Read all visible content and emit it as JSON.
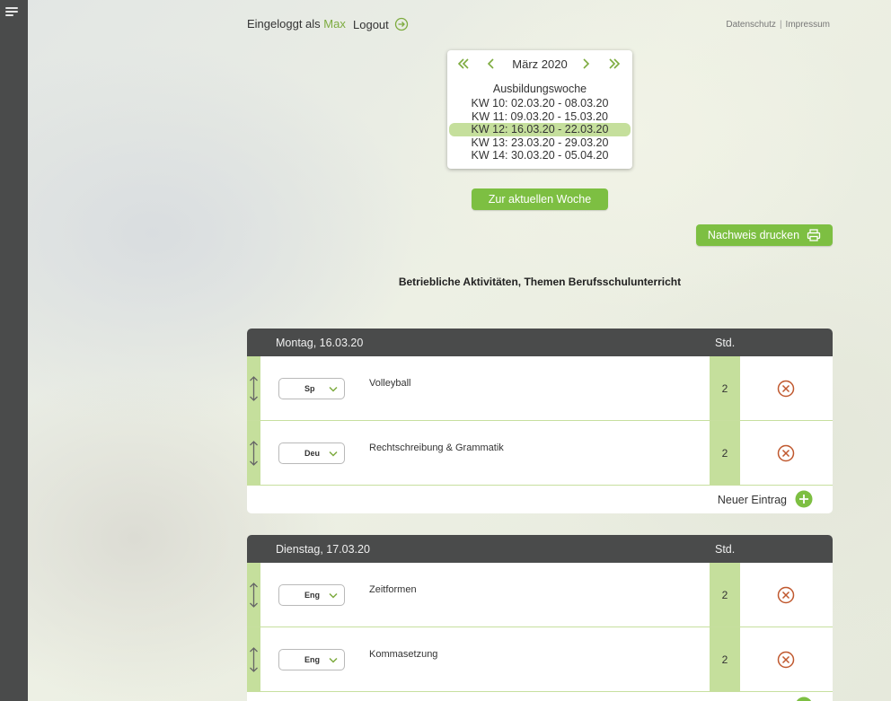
{
  "header": {
    "logged_in_prefix": "Eingeloggt als",
    "user_name": "Max",
    "logout_label": "Logout",
    "privacy_label": "Datenschutz",
    "separator": "|",
    "imprint_label": "Impressum"
  },
  "calendar": {
    "month_label": "März 2020",
    "title": "Ausbildungswoche",
    "weeks": [
      {
        "label": "KW 10: 02.03.20 - 08.03.20",
        "selected": false
      },
      {
        "label": "KW 11: 09.03.20 - 15.03.20",
        "selected": false
      },
      {
        "label": "KW 12: 16.03.20 - 22.03.20",
        "selected": true
      },
      {
        "label": "KW 13: 23.03.20 - 29.03.20",
        "selected": false
      },
      {
        "label": "KW 14: 30.03.20 - 05.04.20",
        "selected": false
      }
    ]
  },
  "actions": {
    "current_week_label": "Zur aktuellen Woche",
    "print_label": "Nachweis drucken"
  },
  "section_title": "Betriebliche Aktivitäten, Themen Berufsschulunterricht",
  "days": [
    {
      "date": "Montag, 16.03.20",
      "hours_header": "Std.",
      "entries": [
        {
          "subject": "Sp",
          "topic": "Volleyball",
          "hours": "2"
        },
        {
          "subject": "Deu",
          "topic": "Rechtschreibung & Grammatik",
          "hours": "2"
        }
      ],
      "new_entry_label": "Neuer Eintrag"
    },
    {
      "date": "Dienstag, 17.03.20",
      "hours_header": "Std.",
      "entries": [
        {
          "subject": "Eng",
          "topic": "Zeitformen",
          "hours": "2"
        },
        {
          "subject": "Eng",
          "topic": "Kommasetzung",
          "hours": "2"
        }
      ]
    }
  ],
  "colors": {
    "accent": "#7dbf42",
    "accent_light": "#c5df9c",
    "sidebar": "#4a4b4b",
    "delete": "#c0582e"
  },
  "icons": {
    "menu": "hamburger-icon",
    "logout": "logout-arrow-icon",
    "prev_year": "double-chevron-left-icon",
    "prev_month": "chevron-left-icon",
    "next_month": "chevron-right-icon",
    "next_year": "double-chevron-right-icon",
    "print": "printer-icon",
    "drag": "drag-handle-icon",
    "delete": "close-circle-icon",
    "add": "plus-circle-icon"
  }
}
